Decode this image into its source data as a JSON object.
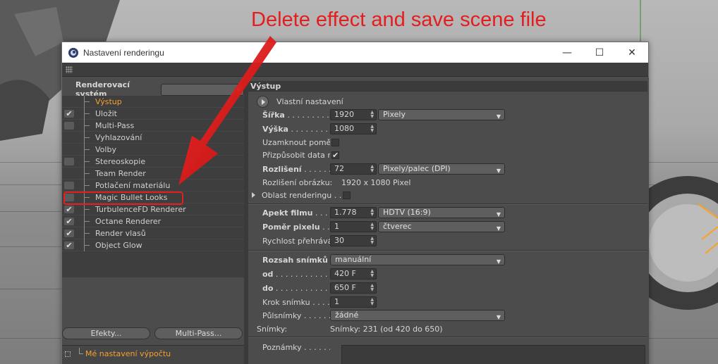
{
  "annotation": {
    "banner": "Delete effect and save scene file"
  },
  "window": {
    "title": "Nastavení renderingu",
    "buttons": {
      "minimize": "—",
      "maximize": "☐",
      "close": "✕"
    }
  },
  "left": {
    "render_system_label": "Renderovací systém",
    "render_system_value": "",
    "items": [
      {
        "label": "Výstup",
        "check": "none",
        "active": true
      },
      {
        "label": "Uložit",
        "check": "on"
      },
      {
        "label": "Multi-Pass",
        "check": "off"
      },
      {
        "label": "Vyhlazování",
        "check": "none"
      },
      {
        "label": "Volby",
        "check": "none"
      },
      {
        "label": "Stereoskopie",
        "check": "off"
      },
      {
        "label": "Team Render",
        "check": "none"
      },
      {
        "label": "Potlačení materiálu",
        "check": "off"
      },
      {
        "label": "Magic Bullet Looks",
        "check": "off"
      },
      {
        "label": "TurbulenceFD Renderer",
        "check": "on"
      },
      {
        "label": "Octane Renderer",
        "check": "on"
      },
      {
        "label": "Render vlasů",
        "check": "on"
      },
      {
        "label": "Object Glow",
        "check": "on"
      }
    ],
    "effects_button": "Efekty...",
    "multipass_button": "Multi-Pass...",
    "preset_label": "Mé nastavení výpočtu"
  },
  "right": {
    "section_title": "Výstup",
    "custom_settings": "Vlastní nastavení",
    "width_label": "Šířka",
    "width_value": "1920",
    "width_unit": "Pixely",
    "height_label": "Výška",
    "height_value": "1080",
    "lock_ratio_label": "Uzamknout poměr",
    "lock_ratio_checked": false,
    "adapt_rate_label": "Přizpůsobit data rate",
    "adapt_rate_checked": true,
    "resolution_label": "Rozlišení",
    "resolution_value": "72",
    "resolution_unit": "Pixely/palec (DPI)",
    "image_res_label": "Rozlišení obrázku:",
    "image_res_value": "1920 x 1080 Pixel",
    "render_region_label": "Oblast renderingu",
    "film_aspect_label": "Apekt filmu",
    "film_aspect_value": "1.778",
    "film_aspect_preset": "HDTV (16:9)",
    "pixel_ratio_label": "Poměr pixelu",
    "pixel_ratio_value": "1",
    "pixel_ratio_preset": "čtverec",
    "fps_label": "Rychlost přehrávání",
    "fps_value": "30",
    "frame_range_label": "Rozsah snímků",
    "frame_range_value": "manuální",
    "from_label": "od",
    "from_value": "420 F",
    "to_label": "do",
    "to_value": "650 F",
    "step_label": "Krok snímku",
    "step_value": "1",
    "fields_label": "Půlsnímky",
    "fields_value": "žádné",
    "frames_label": "Snímky:",
    "frames_value": "Snímky: 231 (od 420 do 650)",
    "notes_label": "Poznámky"
  },
  "colors": {
    "accent": "#f3a230",
    "annotation": "#e41e1e"
  }
}
